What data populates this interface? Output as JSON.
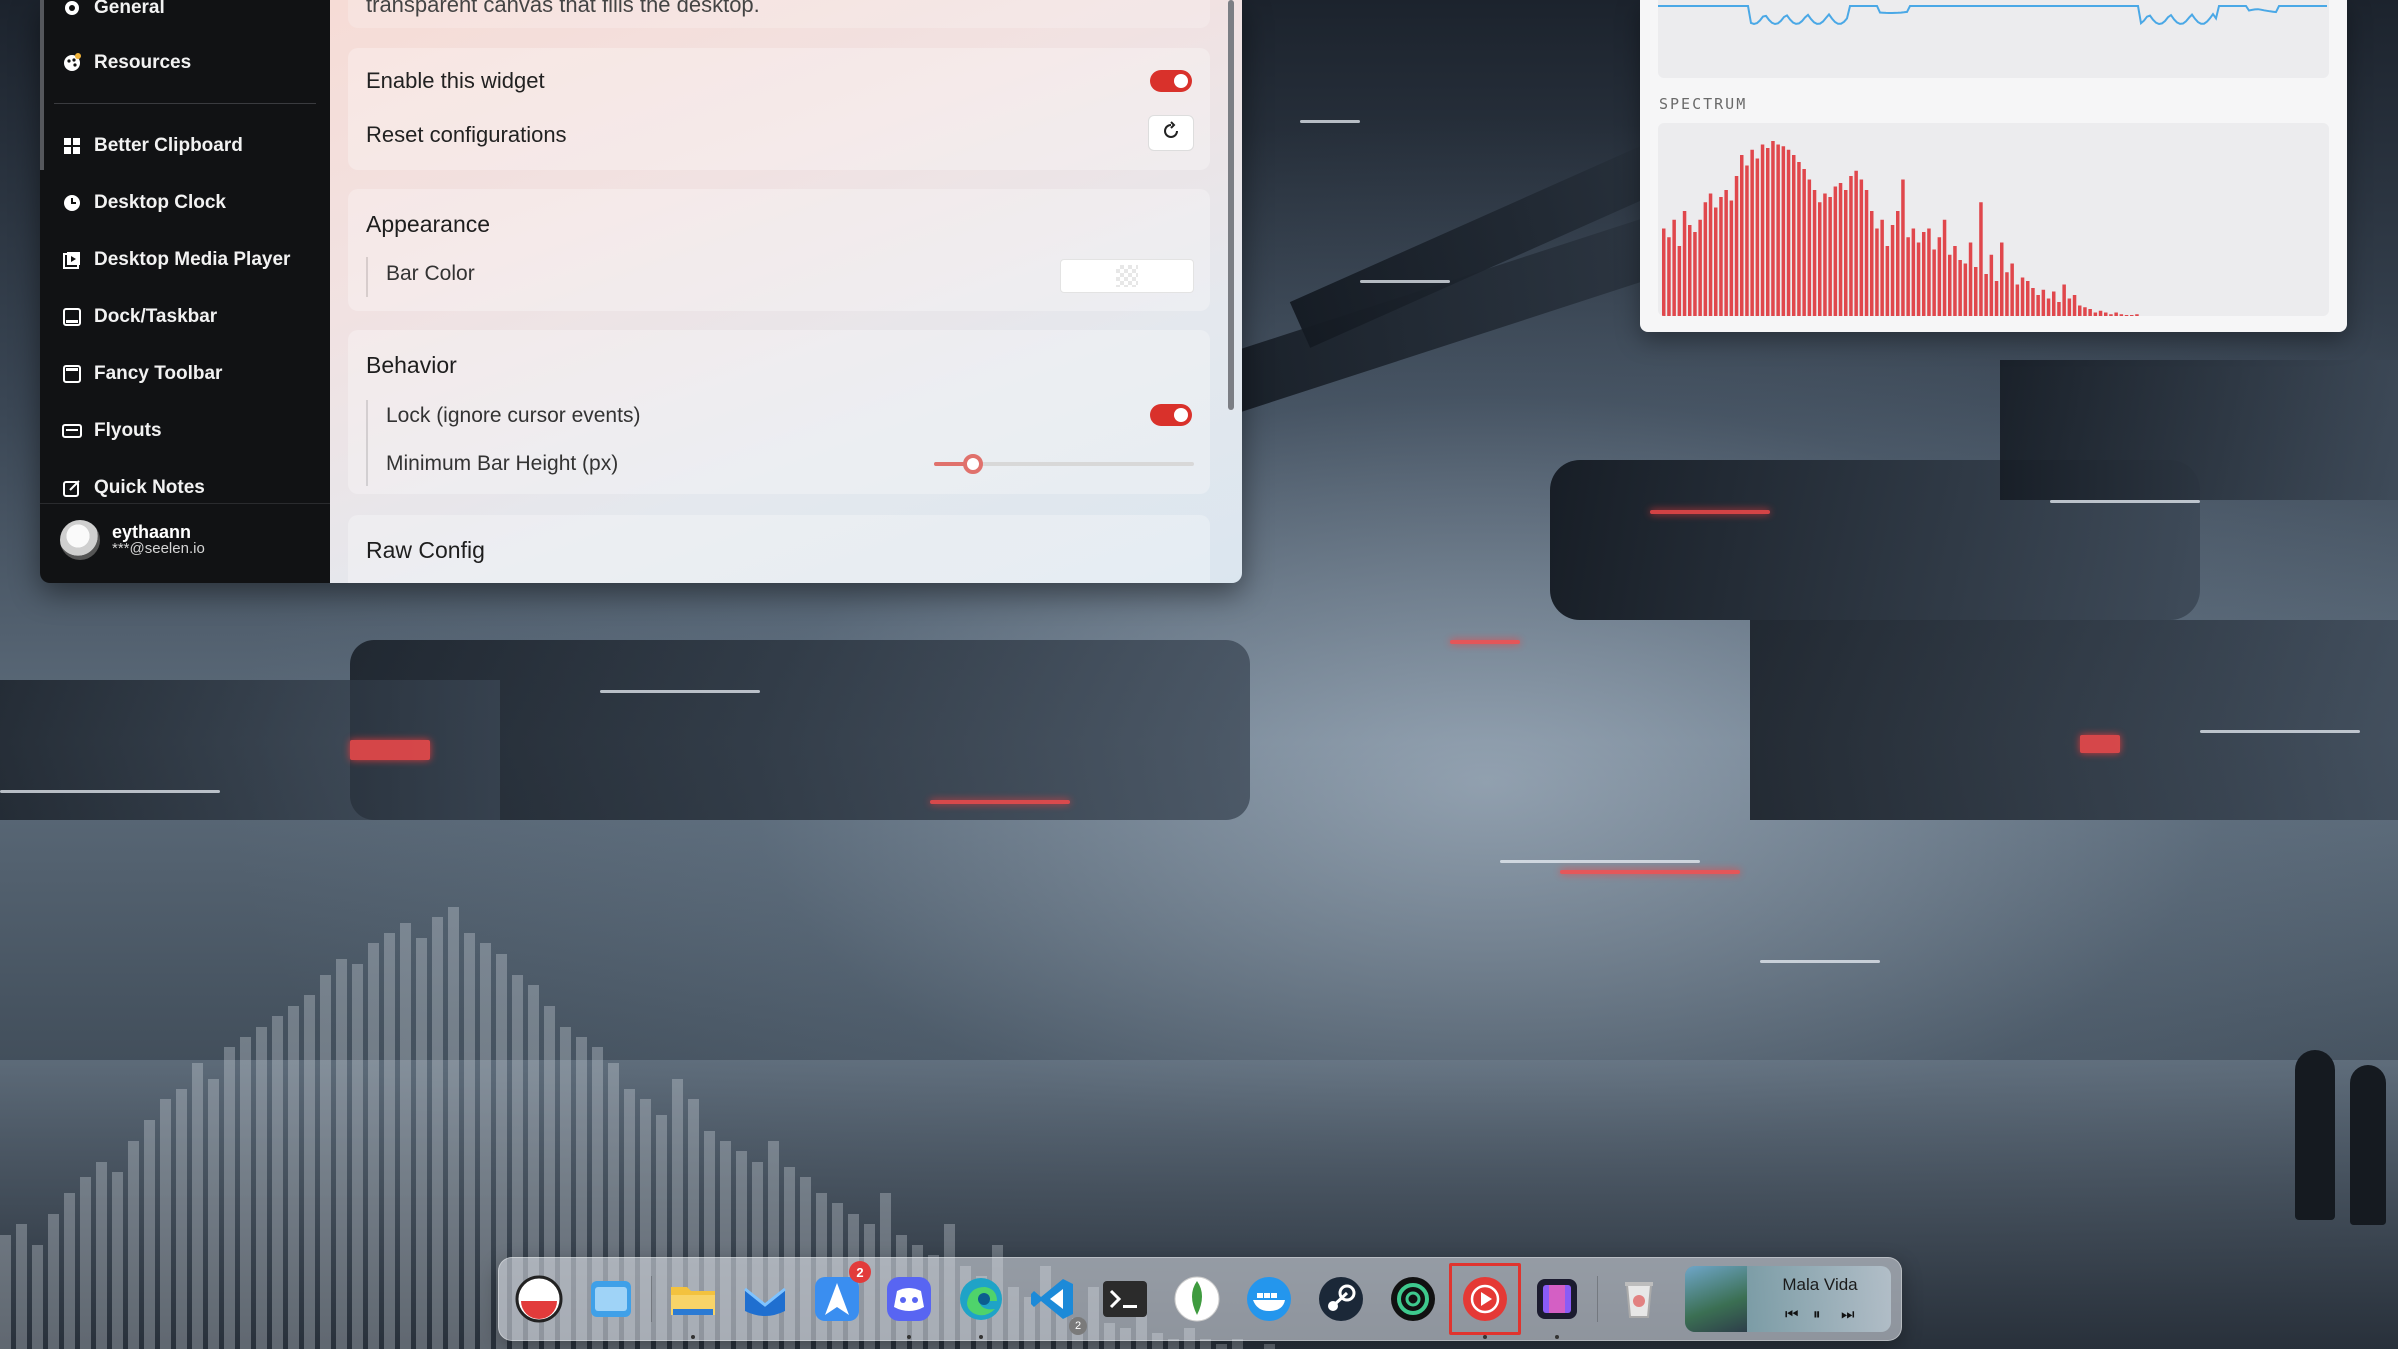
{
  "sidebar": {
    "items": [
      {
        "label": "General",
        "icon": "gear-icon"
      },
      {
        "label": "Resources",
        "icon": "palette-icon"
      },
      {
        "label": "Better Clipboard",
        "icon": "grid-icon"
      },
      {
        "label": "Desktop Clock",
        "icon": "clock-icon"
      },
      {
        "label": "Desktop Media Player",
        "icon": "media-icon"
      },
      {
        "label": "Dock/Taskbar",
        "icon": "dock-icon"
      },
      {
        "label": "Fancy Toolbar",
        "icon": "toolbar-icon"
      },
      {
        "label": "Flyouts",
        "icon": "flyout-icon"
      },
      {
        "label": "Quick Notes",
        "icon": "notes-icon"
      }
    ],
    "user": {
      "name": "eythaann",
      "email": "***@seelen.io"
    }
  },
  "content": {
    "intro_text": "transparent canvas that fills the desktop.",
    "general": {
      "enable_label": "Enable this widget",
      "enable_value": true,
      "reset_label": "Reset configurations"
    },
    "appearance": {
      "title": "Appearance",
      "bar_color_label": "Bar Color"
    },
    "behavior": {
      "title": "Behavior",
      "lock_label": "Lock (ignore cursor events)",
      "lock_value": true,
      "min_bar_height_label": "Minimum Bar Height (px)",
      "min_bar_height_fraction": 0.15
    },
    "raw_config": {
      "title": "Raw Config"
    }
  },
  "resources_widget": {
    "spectrum_label": "SPECTRUM",
    "waveform_color": "#4aa8e6",
    "spectrum_color": "#e0474c",
    "spectrum_levels": [
      0.5,
      0.45,
      0.55,
      0.4,
      0.6,
      0.52,
      0.48,
      0.55,
      0.65,
      0.7,
      0.62,
      0.68,
      0.72,
      0.66,
      0.8,
      0.92,
      0.86,
      0.95,
      0.9,
      0.98,
      0.96,
      1.0,
      0.98,
      0.97,
      0.95,
      0.92,
      0.88,
      0.84,
      0.78,
      0.72,
      0.65,
      0.7,
      0.68,
      0.74,
      0.76,
      0.72,
      0.8,
      0.83,
      0.78,
      0.72,
      0.6,
      0.5,
      0.55,
      0.4,
      0.52,
      0.6,
      0.78,
      0.45,
      0.5,
      0.42,
      0.48,
      0.5,
      0.38,
      0.45,
      0.55,
      0.35,
      0.4,
      0.32,
      0.3,
      0.42,
      0.28,
      0.65,
      0.24,
      0.35,
      0.2,
      0.42,
      0.25,
      0.3,
      0.18,
      0.22,
      0.2,
      0.16,
      0.12,
      0.15,
      0.1,
      0.14,
      0.08,
      0.18,
      0.1,
      0.12,
      0.06,
      0.05,
      0.04,
      0.02,
      0.03,
      0.02,
      0.01,
      0.02,
      0.01,
      0.0,
      0.0,
      0.01
    ]
  },
  "background_visualizer": {
    "levels": [
      0.22,
      0.24,
      0.2,
      0.26,
      0.3,
      0.33,
      0.36,
      0.34,
      0.4,
      0.44,
      0.48,
      0.5,
      0.55,
      0.52,
      0.58,
      0.6,
      0.62,
      0.64,
      0.66,
      0.68,
      0.72,
      0.75,
      0.74,
      0.78,
      0.8,
      0.82,
      0.79,
      0.83,
      0.85,
      0.8,
      0.78,
      0.76,
      0.72,
      0.7,
      0.66,
      0.62,
      0.6,
      0.58,
      0.55,
      0.5,
      0.48,
      0.45,
      0.52,
      0.48,
      0.42,
      0.4,
      0.38,
      0.36,
      0.4,
      0.35,
      0.33,
      0.3,
      0.28,
      0.26,
      0.24,
      0.3,
      0.22,
      0.2,
      0.18,
      0.24,
      0.16,
      0.14,
      0.2,
      0.12,
      0.1,
      0.16,
      0.08,
      0.06,
      0.12,
      0.05,
      0.04,
      0.08,
      0.03,
      0.02,
      0.04,
      0.02,
      0.01,
      0.02,
      0.0,
      0.01
    ]
  },
  "dock": {
    "items": [
      {
        "name": "seelen-ui-app",
        "color": "#e23b3b"
      },
      {
        "name": "window-app",
        "color": "#3fa0e8"
      },
      {
        "name": "file-explorer",
        "color": "#f3c23e"
      },
      {
        "name": "mail-app",
        "color": "#1f6fd0"
      },
      {
        "name": "launcher-app",
        "color": "#3a8ef0",
        "badge": "2"
      },
      {
        "name": "discord-app",
        "color": "#5865f2"
      },
      {
        "name": "edge-browser",
        "color": "#1fa3c7"
      },
      {
        "name": "vscode-app",
        "color": "#1c8ad8",
        "badge_small": "2"
      },
      {
        "name": "terminal-app",
        "color": "#2b2b2b"
      },
      {
        "name": "mongodb-compass",
        "color": "#3f9b3f"
      },
      {
        "name": "docker-app",
        "color": "#2496ed"
      },
      {
        "name": "steam-app",
        "color": "#1b2838"
      },
      {
        "name": "chatgpt-app",
        "color": "#0e7a52"
      },
      {
        "name": "youtube-music-app",
        "color": "#e53935"
      },
      {
        "name": "figma-app",
        "color": "#8a5cf6"
      },
      {
        "name": "recycle-bin",
        "color": "#c9c9c9"
      }
    ],
    "media": {
      "title": "Mala Vida"
    }
  }
}
